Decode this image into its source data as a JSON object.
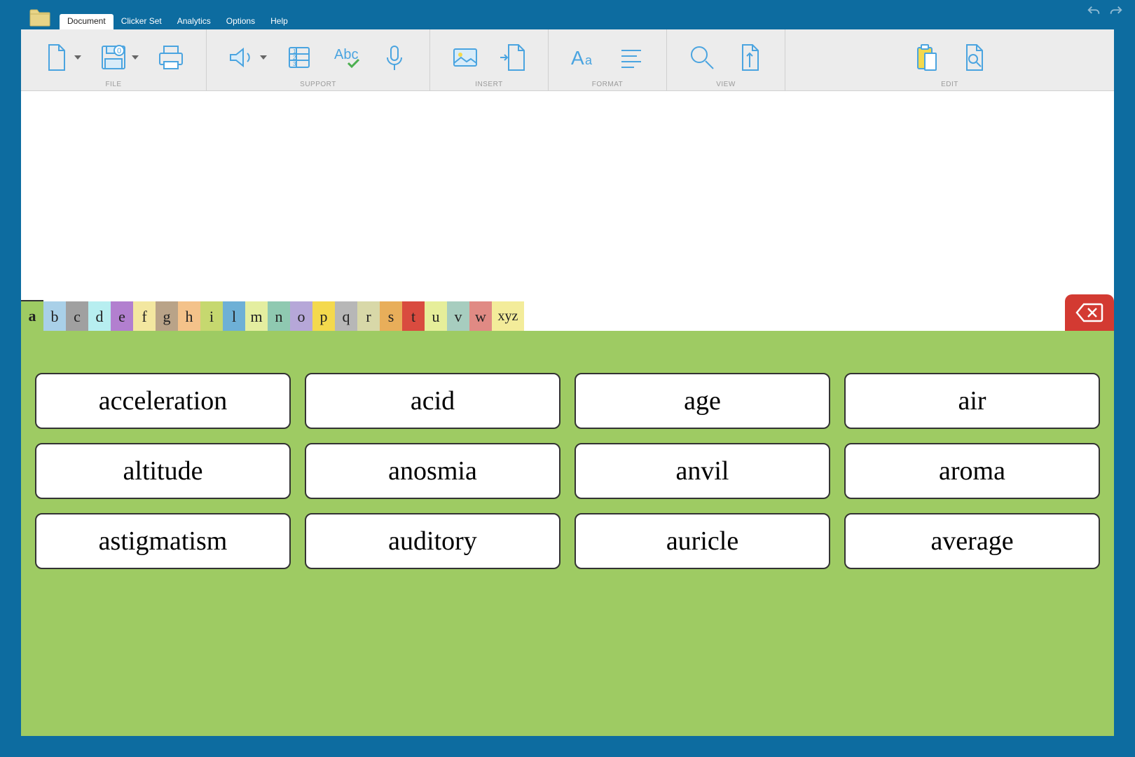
{
  "menu": {
    "tabs": [
      "Document",
      "Clicker Set",
      "Analytics",
      "Options",
      "Help"
    ],
    "active": 0
  },
  "ribbon": {
    "groups": [
      {
        "label": "FILE"
      },
      {
        "label": "SUPPORT"
      },
      {
        "label": "INSERT"
      },
      {
        "label": "FORMAT"
      },
      {
        "label": "VIEW"
      },
      {
        "label": "EDIT"
      }
    ]
  },
  "alphabet": {
    "tabs": [
      {
        "label": "a",
        "color": "#9ecb63",
        "active": true
      },
      {
        "label": "b",
        "color": "#a9d0e8"
      },
      {
        "label": "c",
        "color": "#a0a0a0"
      },
      {
        "label": "d",
        "color": "#b7eef0"
      },
      {
        "label": "e",
        "color": "#b27fcf"
      },
      {
        "label": "f",
        "color": "#f3e7a0"
      },
      {
        "label": "g",
        "color": "#b9a388"
      },
      {
        "label": "h",
        "color": "#f4c28a"
      },
      {
        "label": "i",
        "color": "#c6d86f"
      },
      {
        "label": "l",
        "color": "#6eb0d6"
      },
      {
        "label": "m",
        "color": "#e4eea0"
      },
      {
        "label": "n",
        "color": "#8fc9b1"
      },
      {
        "label": "o",
        "color": "#b6a7d8"
      },
      {
        "label": "p",
        "color": "#f4d94d"
      },
      {
        "label": "q",
        "color": "#b7b7b7"
      },
      {
        "label": "r",
        "color": "#d8d8a8"
      },
      {
        "label": "s",
        "color": "#e8ae5a"
      },
      {
        "label": "t",
        "color": "#d94b3f"
      },
      {
        "label": "u",
        "color": "#e6ee9a"
      },
      {
        "label": "v",
        "color": "#a7cdbf"
      },
      {
        "label": "w",
        "color": "#e08a84"
      },
      {
        "label": "xyz",
        "color": "#f3ec9a"
      }
    ]
  },
  "words": [
    "acceleration",
    "acid",
    "age",
    "air",
    "altitude",
    "anosmia",
    "anvil",
    "aroma",
    "astigmatism",
    "auditory",
    "auricle",
    "average"
  ]
}
